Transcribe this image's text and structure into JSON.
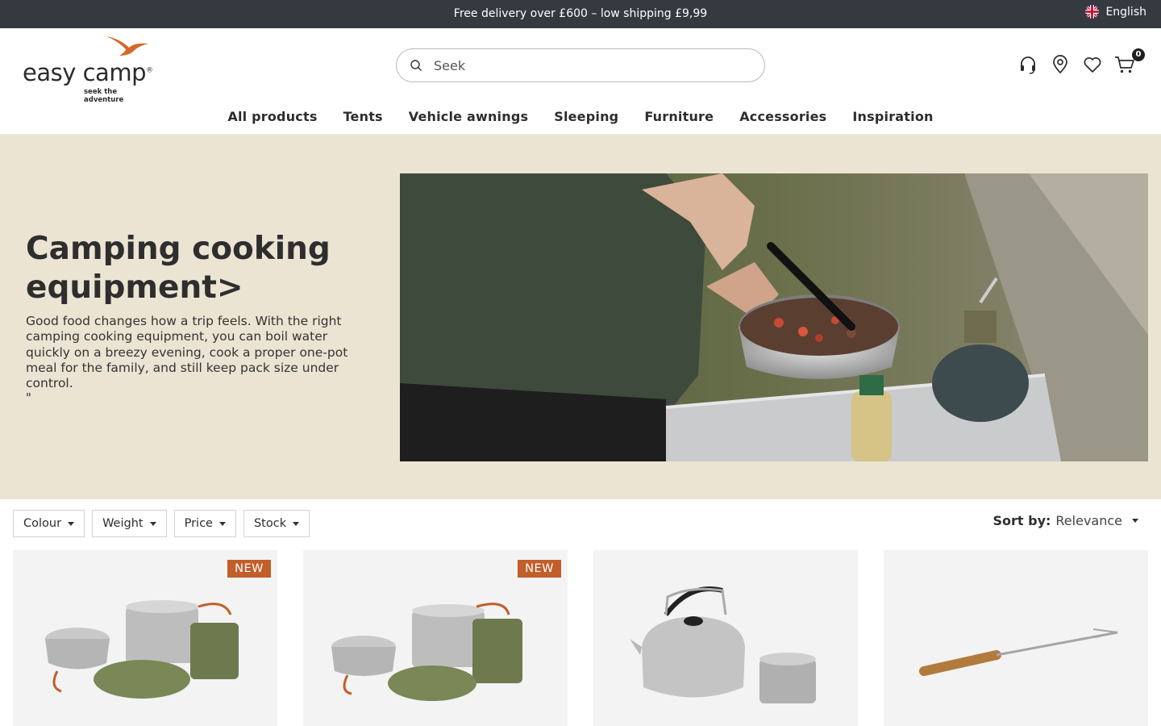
{
  "topbar": {
    "promo": "Free delivery over £600 – low shipping £9,99",
    "language": "English"
  },
  "header": {
    "logo_text": "easy camp",
    "logo_tagline": "seek the adventure",
    "search_placeholder": "Seek",
    "cart_count": "0",
    "icons": [
      "headset-icon",
      "location-icon",
      "heart-icon",
      "cart-icon"
    ]
  },
  "nav": {
    "items": [
      "All products",
      "Tents",
      "Vehicle awnings",
      "Sleeping",
      "Furniture",
      "Accessories",
      "Inspiration"
    ]
  },
  "hero": {
    "title": "Camping cooking equipment>",
    "description": "Good food changes how a trip feels. With the right camping cooking equipment, you can boil water quickly on a breezy evening, cook a proper one-pot meal for the family, and still keep pack size under control.",
    "trailing_mark": "\""
  },
  "filters": {
    "buttons": [
      "Colour",
      "Weight",
      "Price",
      "Stock"
    ],
    "sort_label": "Sort by:",
    "sort_value": "Relevance"
  },
  "products": [
    {
      "badge": "NEW"
    },
    {
      "badge": "NEW"
    },
    {
      "badge": ""
    },
    {
      "badge": ""
    }
  ],
  "colors": {
    "topbar_bg": "#353a40",
    "hero_bg": "#ebe4d3",
    "badge_bg": "#c25e2a",
    "brand_orange": "#d2692a"
  }
}
